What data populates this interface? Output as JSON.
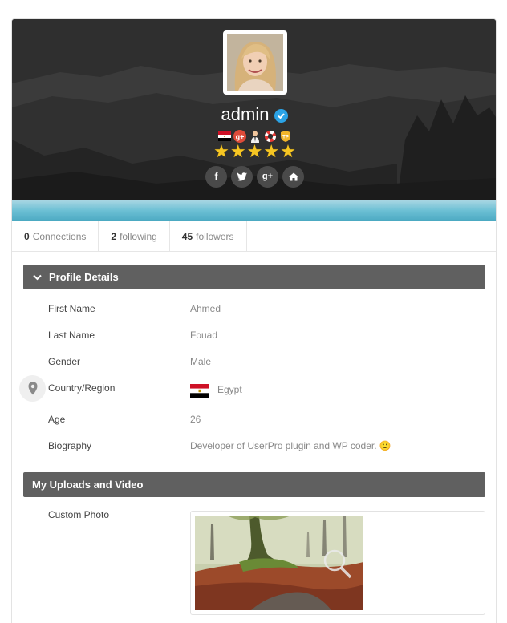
{
  "profile": {
    "username": "admin",
    "verified": true,
    "badges": [
      "egypt-flag-badge",
      "google-plus-badge",
      "business-user-badge",
      "lifebuoy-badge",
      "tp-shield-badge"
    ],
    "rating_stars": 5,
    "social": [
      "facebook-icon",
      "twitter-icon",
      "google-plus-icon",
      "home-icon"
    ]
  },
  "stats": {
    "connections": {
      "count": "0",
      "label": "Connections"
    },
    "following": {
      "count": "2",
      "label": "following"
    },
    "followers": {
      "count": "45",
      "label": "followers"
    }
  },
  "details": {
    "title": "Profile Details",
    "fields": [
      {
        "label": "First Name",
        "value": "Ahmed"
      },
      {
        "label": "Last Name",
        "value": "Fouad"
      },
      {
        "label": "Gender",
        "value": "Male"
      },
      {
        "label": "Country/Region",
        "value": "Egypt"
      },
      {
        "label": "Age",
        "value": "26"
      },
      {
        "label": "Biography",
        "value": "Developer of UserPro plugin and WP coder. 🙂"
      }
    ]
  },
  "uploads": {
    "title": "My Uploads and Video",
    "custom_photo_label": "Custom Photo"
  },
  "colors": {
    "section_header": "#606060",
    "verified_blue": "#2ba3e6",
    "star_gold": "#f6c623",
    "cover_strip": "#6bbfd4"
  }
}
